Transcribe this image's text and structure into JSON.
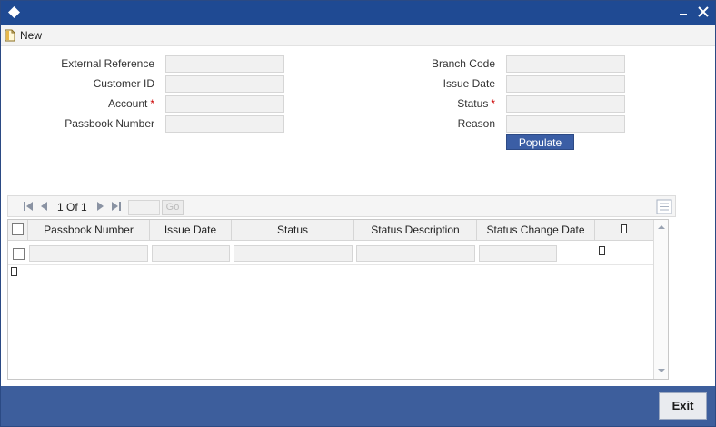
{
  "titlebar": {
    "minimize_icon": "minimize-icon",
    "close_icon": "close-icon",
    "app_icon": "diamond-icon"
  },
  "toolbar": {
    "new_label": "New",
    "new_icon": "document-icon"
  },
  "form": {
    "external_reference": {
      "label": "External Reference",
      "value": ""
    },
    "customer_id": {
      "label": "Customer ID",
      "value": ""
    },
    "account": {
      "label": "Account",
      "value": "",
      "required": "*"
    },
    "passbook_number": {
      "label": "Passbook Number",
      "value": ""
    },
    "branch_code": {
      "label": "Branch Code",
      "value": ""
    },
    "issue_date": {
      "label": "Issue Date",
      "value": ""
    },
    "status": {
      "label": "Status",
      "value": "",
      "required": "*"
    },
    "reason": {
      "label": "Reason",
      "value": ""
    },
    "populate_label": "Populate"
  },
  "pager": {
    "page_text": "1 Of 1",
    "page_input": "",
    "go_label": "Go"
  },
  "grid": {
    "columns": [
      "Passbook Number",
      "Issue Date",
      "Status",
      "Status Description",
      "Status Change Date"
    ],
    "rows": [
      {
        "passbook_number": "",
        "issue_date": "",
        "status": "",
        "status_description": "",
        "status_change_date": ""
      }
    ]
  },
  "footer": {
    "exit_label": "Exit"
  },
  "colors": {
    "titlebar": "#1f4a93",
    "footer": "#3d5e9c",
    "button": "#3b5ea5",
    "required": "#cc0000"
  }
}
